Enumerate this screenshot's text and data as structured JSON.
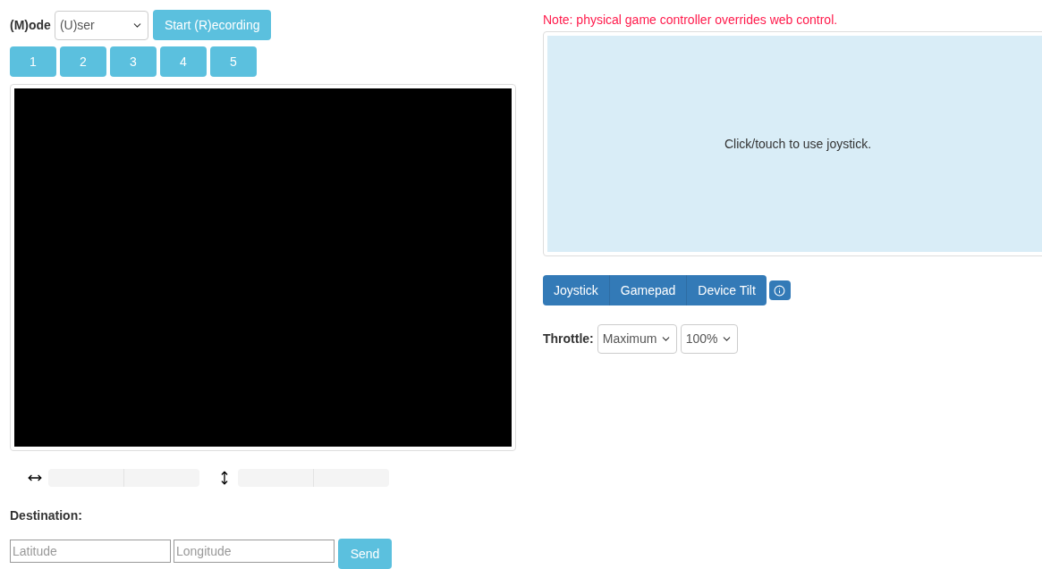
{
  "mode": {
    "label": "(M)ode",
    "value": "(U)ser"
  },
  "record_button": "Start (R)ecording",
  "number_buttons": [
    "1",
    "2",
    "3",
    "4",
    "5"
  ],
  "controls_note": "Note: physical game controller overrides web control.",
  "joystick_area": {
    "hint": "Click/touch to use joystick."
  },
  "control_tabs": [
    "Joystick",
    "Gamepad",
    "Device Tilt"
  ],
  "throttle": {
    "label": "Throttle:",
    "mode": "Maximum",
    "percent": "100%"
  },
  "destination": {
    "label": "Destination:",
    "latitude_placeholder": "Latitude",
    "longitude_placeholder": "Longitude",
    "send": "Send"
  }
}
